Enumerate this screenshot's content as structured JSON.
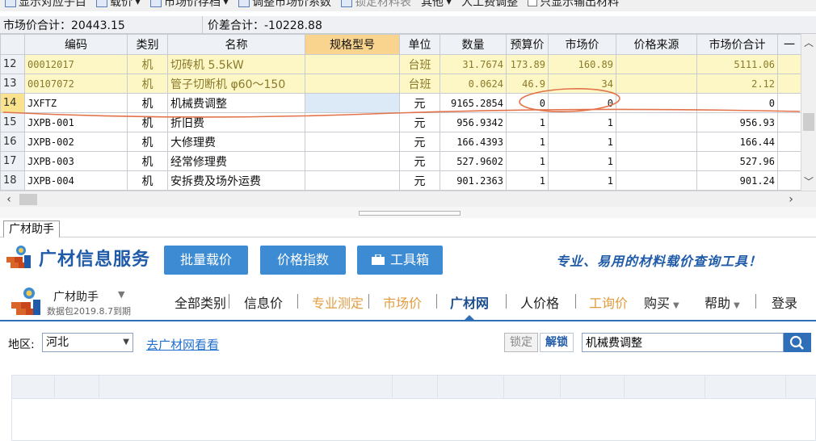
{
  "toolbar": {
    "items": [
      "显示对应子目",
      "载价",
      "市场价存档",
      "调整市场价系数",
      "锁定材料表",
      "其他",
      "人工费调整",
      "只显示输出材料"
    ]
  },
  "summary": {
    "market_total": "市场价合计：20443.15",
    "diff_total": "价差合计：-10228.88"
  },
  "grid": {
    "headers": [
      "编码",
      "类别",
      "名称",
      "规格型号",
      "单位",
      "数量",
      "预算价",
      "市场价",
      "价格来源",
      "市场价合计"
    ],
    "rows": [
      {
        "rn": "12",
        "code": "00012017",
        "cat": "机",
        "name": "切砖机 5.5kW",
        "spec": "",
        "unit": "台班",
        "qty": "31.7674",
        "budget": "173.89",
        "market": "160.89",
        "source": "",
        "total": "5111.06"
      },
      {
        "rn": "13",
        "code": "00107072",
        "cat": "机",
        "name": "管子切断机 φ60～150",
        "spec": "",
        "unit": "台班",
        "qty": "0.0624",
        "budget": "46.9",
        "market": "34",
        "source": "",
        "total": "2.12"
      },
      {
        "rn": "14",
        "code": "JXFTZ",
        "cat": "机",
        "name": "机械费调整",
        "spec": "",
        "unit": "元",
        "qty": "9165.2854",
        "budget": "0",
        "market": "0",
        "source": "",
        "total": "0"
      },
      {
        "rn": "15",
        "code": "JXPB-001",
        "cat": "机",
        "name": "折旧费",
        "spec": "",
        "unit": "元",
        "qty": "956.9342",
        "budget": "1",
        "market": "1",
        "source": "",
        "total": "956.93"
      },
      {
        "rn": "16",
        "code": "JXPB-002",
        "cat": "机",
        "name": "大修理费",
        "spec": "",
        "unit": "元",
        "qty": "166.4393",
        "budget": "1",
        "market": "1",
        "source": "",
        "total": "166.44"
      },
      {
        "rn": "17",
        "code": "JXPB-003",
        "cat": "机",
        "name": "经常修理费",
        "spec": "",
        "unit": "元",
        "qty": "527.9602",
        "budget": "1",
        "market": "1",
        "source": "",
        "total": "527.96"
      },
      {
        "rn": "18",
        "code": "JXPB-004",
        "cat": "机",
        "name": "安拆费及场外运费",
        "spec": "",
        "unit": "元",
        "qty": "901.2363",
        "budget": "1",
        "market": "1",
        "source": "",
        "total": "901.24"
      }
    ]
  },
  "panel": {
    "tab_label": "广材助手"
  },
  "banner": {
    "logo_text": "广材信息服务",
    "buttons": [
      "批量载价",
      "价格指数",
      "工具箱"
    ],
    "slogan": "专业、易用的材料载价查询工具！"
  },
  "nav": {
    "package_name": "广材助手",
    "package_date": "数据包2019.8.7到期",
    "items": [
      "全部类别",
      "信息价",
      "专业测定",
      "市场价",
      "广材网",
      "人价格",
      "工询价",
      "购买",
      "帮助",
      "登录"
    ]
  },
  "filter": {
    "region_label": "地区:",
    "region_value": "河北",
    "link_text": "去广材网看看",
    "lock_label": "锁定",
    "unlock_label": "解锁",
    "search_value": "机械费调整"
  },
  "colors": {
    "accent_blue": "#3d8cd3",
    "brand_blue": "#1f5ba8",
    "orange": "#e39c3f",
    "row_yellow": "#fcf7c5",
    "annotation": "#e2724a"
  }
}
